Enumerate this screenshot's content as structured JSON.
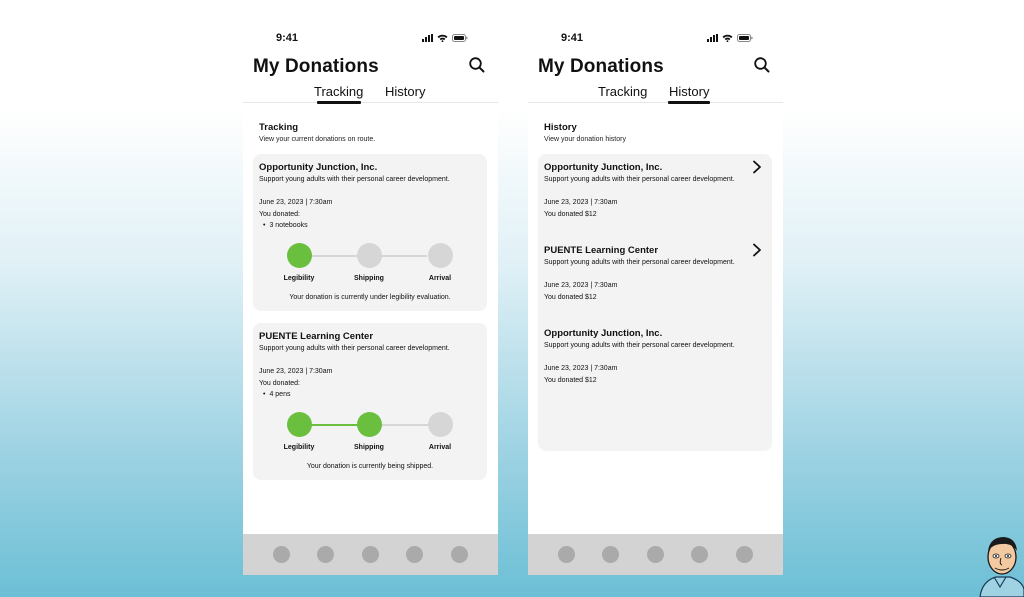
{
  "colors": {
    "accent_green": "#6bbf3f",
    "inactive_step": "#d6d6d6",
    "card_bg": "#f3f3f3",
    "nav_bg": "#d3d3d3",
    "nav_dot": "#aaaaaa"
  },
  "status": {
    "time": "9:41"
  },
  "app": {
    "title": "My Donations"
  },
  "tabs": [
    "Tracking",
    "History"
  ],
  "tracking_screen": {
    "active_tab": "Tracking",
    "section_title": "Tracking",
    "section_subtitle": "View your current donations on route.",
    "cards": [
      {
        "org": "Opportunity Junction, Inc.",
        "description": "Support young adults with their personal career development.",
        "datetime": "June 23, 2023 | 7:30am",
        "donated_label": "You donated:",
        "item": "3 notebooks",
        "steps": [
          "Legibility",
          "Shipping",
          "Arrival"
        ],
        "completed_steps": 1,
        "status_message": "Your donation is currently under legibility evaluation."
      },
      {
        "org": "PUENTE Learning Center",
        "description": "Support young adults with their personal career development.",
        "datetime": "June 23, 2023 | 7:30am",
        "donated_label": "You donated:",
        "item": "4 pens",
        "steps": [
          "Legibility",
          "Shipping",
          "Arrival"
        ],
        "completed_steps": 2,
        "status_message": "Your donation is currently being shipped."
      }
    ]
  },
  "history_screen": {
    "active_tab": "History",
    "section_title": "History",
    "section_subtitle": "View your donation history",
    "items": [
      {
        "org": "Opportunity Junction, Inc.",
        "description": "Support young adults with their personal career development.",
        "datetime": "June 23, 2023 | 7:30am",
        "donated": "You donated $12",
        "has_chevron": true
      },
      {
        "org": "PUENTE Learning Center",
        "description": "Support young adults with their personal career development.",
        "datetime": "June 23, 2023 | 7:30am",
        "donated": "You donated $12",
        "has_chevron": true
      },
      {
        "org": "Opportunity Junction, Inc.",
        "description": "Support young adults with their personal career development.",
        "datetime": "June 23, 2023 | 7:30am",
        "donated": "You donated $12",
        "has_chevron": false
      }
    ]
  },
  "icons": {
    "search": "search-icon",
    "chevron": "chevron-right-icon",
    "signal": "signal-icon",
    "wifi": "wifi-icon",
    "battery": "battery-icon"
  },
  "bottom_nav": {
    "item_count": 5
  }
}
